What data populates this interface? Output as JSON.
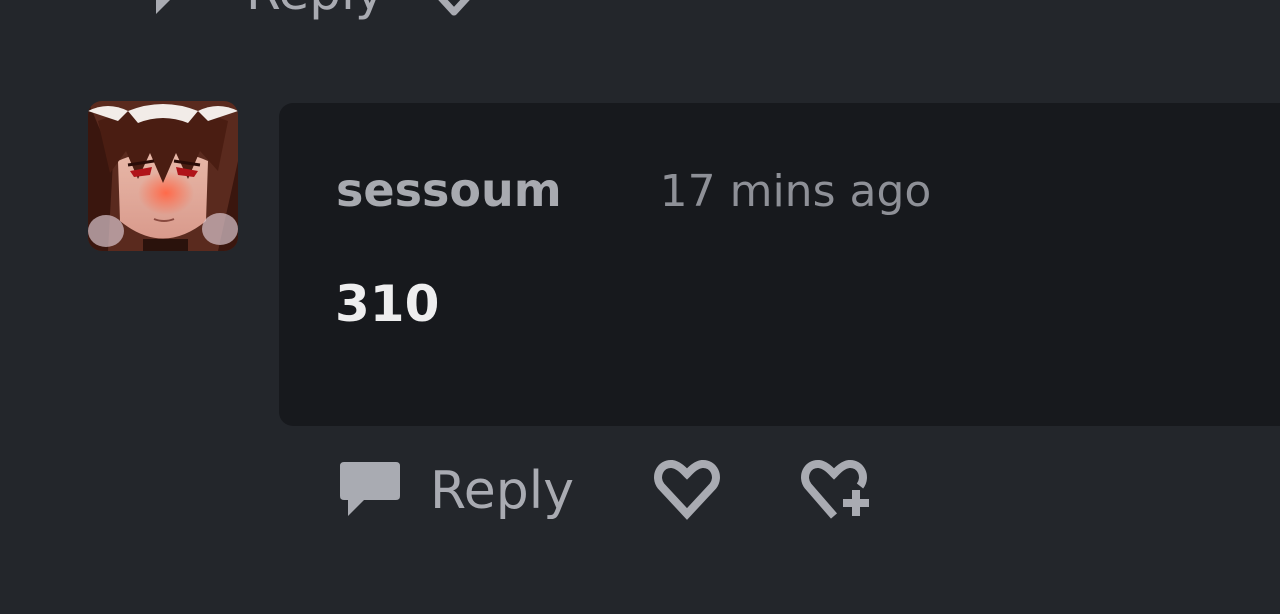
{
  "previous_comment": {
    "reply_label": "Reply"
  },
  "comment": {
    "username": "sessoum",
    "timestamp": "17 mins ago",
    "text": "310",
    "avatar_alt": "user avatar"
  },
  "actions": {
    "reply_label": "Reply",
    "icons": [
      "reply-bubble-icon",
      "heart-icon",
      "heart-plus-icon"
    ]
  },
  "colors": {
    "background": "#23262b",
    "bubble": "#17191d",
    "muted_text": "#a9abb2",
    "comment_text": "#eeeeef"
  }
}
